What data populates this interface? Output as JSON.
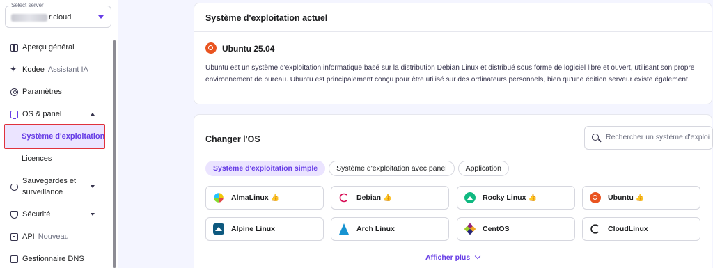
{
  "sidebar": {
    "server_select": {
      "label": "Select server",
      "value": "r.cloud"
    },
    "items": [
      {
        "label": "Aperçu général",
        "icon": "grid-icon"
      },
      {
        "label": "Kodee",
        "sub": "Assistant IA",
        "icon": "sparkle-icon"
      },
      {
        "label": "Paramètres",
        "icon": "gear-icon"
      },
      {
        "label": "OS & panel",
        "icon": "monitor-icon"
      },
      {
        "label": "Système d'exploitation"
      },
      {
        "label": "Licences"
      },
      {
        "label": "Sauvegardes et surveillance",
        "icon": "refresh-icon"
      },
      {
        "label": "Sécurité",
        "icon": "shield-icon"
      },
      {
        "label": "API",
        "sub": "Nouveau",
        "icon": "api-icon"
      },
      {
        "label": "Gestionnaire DNS",
        "icon": "dns-icon"
      }
    ]
  },
  "current_os": {
    "title": "Système d'exploitation actuel",
    "name": "Ubuntu 25.04",
    "description": "Ubuntu est un système d'exploitation informatique basé sur la distribution Debian Linux et distribué sous forme de logiciel libre et ouvert, utilisant son propre environnement de bureau. Ubuntu est principalement conçu pour être utilisé sur des ordinateurs personnels, bien qu'une édition serveur existe également."
  },
  "change_os": {
    "title": "Changer l'OS",
    "search_placeholder": "Rechercher un système d'exploita...",
    "tabs": [
      "Système d'exploitation simple",
      "Système d'exploitation avec panel",
      "Application"
    ],
    "os_list": [
      {
        "name": "AlmaLinux",
        "icon": "almalinux-icon",
        "thumb": "👍"
      },
      {
        "name": "Debian",
        "icon": "debian-icon",
        "thumb": "👍"
      },
      {
        "name": "Rocky Linux",
        "icon": "rocky-linux-icon",
        "thumb": "👍"
      },
      {
        "name": "Ubuntu",
        "icon": "ubuntu-icon",
        "thumb": "👍"
      },
      {
        "name": "Alpine Linux",
        "icon": "alpine-linux-icon"
      },
      {
        "name": "Arch Linux",
        "icon": "arch-linux-icon"
      },
      {
        "name": "CentOS",
        "icon": "centos-icon"
      },
      {
        "name": "CloudLinux",
        "icon": "cloudlinux-icon"
      }
    ],
    "show_more": "Afficher plus"
  },
  "colors": {
    "accent": "#673de6",
    "background": "#f4f5ff",
    "highlight_border": "#e0323c"
  }
}
